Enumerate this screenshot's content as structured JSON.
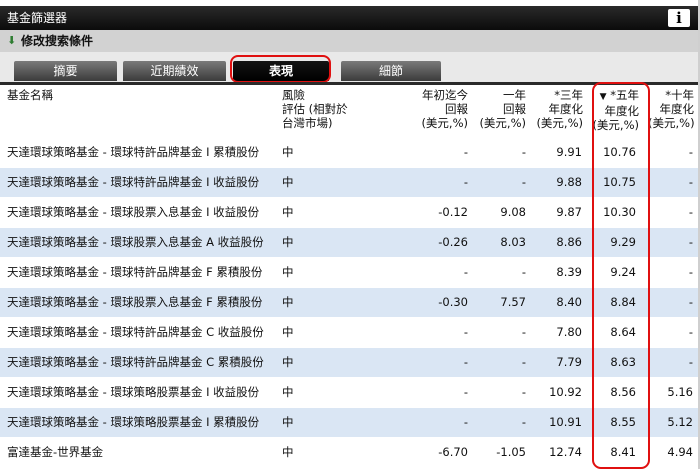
{
  "window": {
    "title": "基金篩選器",
    "info_label": "i"
  },
  "criteria": {
    "label": "修改搜索條件",
    "arrow_icon": "green-down-arrow-icon"
  },
  "tabs": [
    {
      "label": "摘要",
      "active": false
    },
    {
      "label": "近期績效",
      "active": false
    },
    {
      "label": "表現",
      "active": true
    },
    {
      "label": "細節",
      "active": false
    }
  ],
  "columns": {
    "name": "基金名稱",
    "risk": "風險\n評估 (相對於\n台灣市場)",
    "ytd": "年初迄今\n回報\n(美元,%)",
    "y1": "一年\n回報\n(美元,%)",
    "y3": "*三年\n年度化\n(美元,%)",
    "y5": "*五年\n年度化\n(美元,%)",
    "y5_sort": "▼",
    "y10": "*十年\n年度化\n(美元,%)"
  },
  "rows": [
    {
      "name": "天達環球策略基金 - 環球特許品牌基金 I 累積股份",
      "risk": "中",
      "ytd": "-",
      "y1": "-",
      "y3": "9.91",
      "y5": "10.76",
      "y10": "-"
    },
    {
      "name": "天達環球策略基金 - 環球特許品牌基金 I 收益股份",
      "risk": "中",
      "ytd": "-",
      "y1": "-",
      "y3": "9.88",
      "y5": "10.75",
      "y10": "-"
    },
    {
      "name": "天達環球策略基金 - 環球股票入息基金 I 收益股份",
      "risk": "中",
      "ytd": "-0.12",
      "y1": "9.08",
      "y3": "9.87",
      "y5": "10.30",
      "y10": "-"
    },
    {
      "name": "天達環球策略基金 - 環球股票入息基金 A 收益股份",
      "risk": "中",
      "ytd": "-0.26",
      "y1": "8.03",
      "y3": "8.86",
      "y5": "9.29",
      "y10": "-"
    },
    {
      "name": "天達環球策略基金 - 環球特許品牌基金 F 累積股份",
      "risk": "中",
      "ytd": "-",
      "y1": "-",
      "y3": "8.39",
      "y5": "9.24",
      "y10": "-"
    },
    {
      "name": "天達環球策略基金 - 環球股票入息基金 F 累積股份",
      "risk": "中",
      "ytd": "-0.30",
      "y1": "7.57",
      "y3": "8.40",
      "y5": "8.84",
      "y10": "-"
    },
    {
      "name": "天達環球策略基金 - 環球特許品牌基金 C 收益股份",
      "risk": "中",
      "ytd": "-",
      "y1": "-",
      "y3": "7.80",
      "y5": "8.64",
      "y10": "-"
    },
    {
      "name": "天達環球策略基金 - 環球特許品牌基金 C 累積股份",
      "risk": "中",
      "ytd": "-",
      "y1": "-",
      "y3": "7.79",
      "y5": "8.63",
      "y10": "-"
    },
    {
      "name": "天達環球策略基金 - 環球策略股票基金 I 收益股份",
      "risk": "中",
      "ytd": "-",
      "y1": "-",
      "y3": "10.92",
      "y5": "8.56",
      "y10": "5.16"
    },
    {
      "name": "天達環球策略基金 - 環球策略股票基金 I 累積股份",
      "risk": "中",
      "ytd": "-",
      "y1": "-",
      "y3": "10.91",
      "y5": "8.55",
      "y10": "5.12"
    },
    {
      "name": "富達基金-世界基金",
      "risk": "中",
      "ytd": "-6.70",
      "y1": "-1.05",
      "y3": "12.74",
      "y5": "8.41",
      "y10": "4.94"
    }
  ],
  "colors": {
    "alt_row": "#dae6f4",
    "highlight": "#e01010",
    "active_tab": "#000000"
  }
}
